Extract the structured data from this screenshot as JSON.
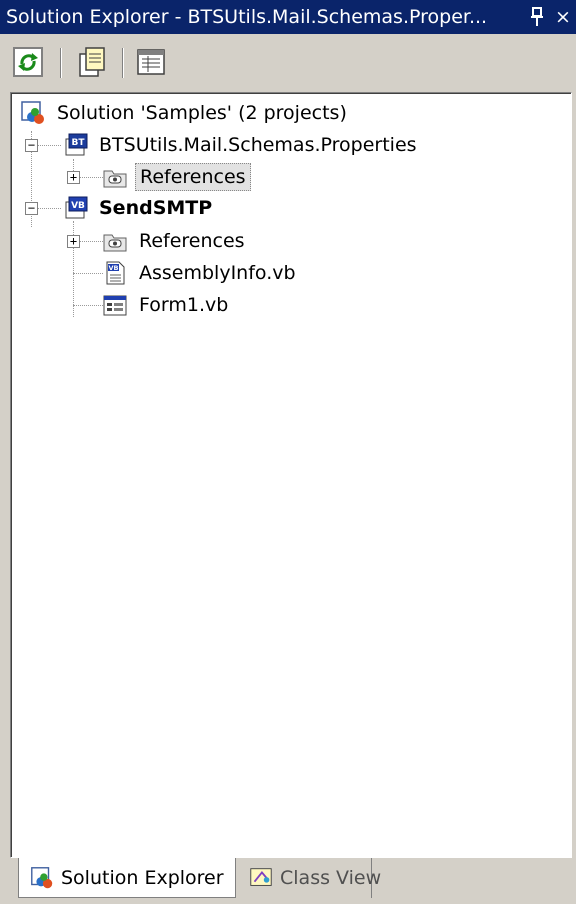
{
  "window": {
    "title": "Solution Explorer - BTSUtils.Mail.Schemas.Proper...",
    "pin_glyph": "Ѩ",
    "close_glyph": "×"
  },
  "toolbar": {
    "buttons": [
      {
        "icon": "refresh-icon"
      },
      {
        "icon": "show-all-files-icon"
      },
      {
        "icon": "properties-icon"
      }
    ]
  },
  "tree": {
    "solution": {
      "label": "Solution 'Samples' (2 projects)",
      "icon": "solution-icon"
    },
    "projects": [
      {
        "label": "BTSUtils.Mail.Schemas.Properties",
        "icon": "biztalk-project-icon",
        "expanded": true,
        "bold": false,
        "children": [
          {
            "label": "References",
            "icon": "references-icon",
            "expandable": true,
            "selected": true
          }
        ]
      },
      {
        "label": "SendSMTP",
        "icon": "vb-project-icon",
        "expanded": true,
        "bold": true,
        "children": [
          {
            "label": "References",
            "icon": "references-icon",
            "expandable": true,
            "selected": false
          },
          {
            "label": "AssemblyInfo.vb",
            "icon": "vb-file-icon",
            "expandable": false,
            "selected": false
          },
          {
            "label": "Form1.vb",
            "icon": "form-icon",
            "expandable": false,
            "selected": false
          }
        ]
      }
    ]
  },
  "tabs": [
    {
      "label": "Solution Explorer",
      "icon": "solution-icon",
      "active": true
    },
    {
      "label": "Class View",
      "icon": "class-view-icon",
      "active": false
    }
  ],
  "colors": {
    "titlebar": "#0a246a",
    "face": "#d4d0c8",
    "tree_bg": "#ffffff"
  }
}
